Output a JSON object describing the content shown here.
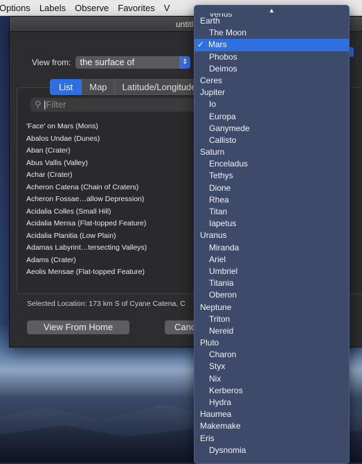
{
  "menubar": {
    "items": [
      "Options",
      "Labels",
      "Observe",
      "Favorites",
      "V"
    ]
  },
  "window": {
    "title": "untitle"
  },
  "view_from": {
    "label": "View from:",
    "value": "the surface of"
  },
  "tabs": [
    "List",
    "Map",
    "Latitude/Longitude"
  ],
  "search": {
    "placeholder": "Filter"
  },
  "locations": [
    "'Face' on Mars (Mons)",
    "Abalos Undae (Dunes)",
    "Aban (Crater)",
    "Abus Vallis (Valley)",
    "Achar (Crater)",
    "Acheron Catena (Chain of Craters)",
    "Acheron Fossae…allow Depression)",
    "Acidalia Colles (Small Hill)",
    "Acidalia Mensa (Flat-topped Feature)",
    "Acidalia Planitia (Low Plain)",
    "Adamas Labyrint…tersecting Valleys)",
    "Adams (Crater)",
    "Aeolis Mensae (Flat-topped Feature)"
  ],
  "selected_location": "Selected Location:  173 km S of Cyane Catena, C",
  "buttons": {
    "home": "View From Home",
    "cancel": "Canc"
  },
  "popup": {
    "up_arrow": "▲",
    "cut_item": "Venus",
    "selected_check": "✓",
    "items": [
      {
        "label": "Earth",
        "indent": 0
      },
      {
        "label": "The Moon",
        "indent": 1
      },
      {
        "label": "Mars",
        "indent": 0,
        "selected": true
      },
      {
        "label": "Phobos",
        "indent": 1
      },
      {
        "label": "Deimos",
        "indent": 1
      },
      {
        "label": "Ceres",
        "indent": 0
      },
      {
        "label": "Jupiter",
        "indent": 0
      },
      {
        "label": "Io",
        "indent": 1
      },
      {
        "label": "Europa",
        "indent": 1
      },
      {
        "label": "Ganymede",
        "indent": 1
      },
      {
        "label": "Callisto",
        "indent": 1
      },
      {
        "label": "Saturn",
        "indent": 0
      },
      {
        "label": "Enceladus",
        "indent": 1
      },
      {
        "label": "Tethys",
        "indent": 1
      },
      {
        "label": "Dione",
        "indent": 1
      },
      {
        "label": "Rhea",
        "indent": 1
      },
      {
        "label": "Titan",
        "indent": 1
      },
      {
        "label": "Iapetus",
        "indent": 1
      },
      {
        "label": "Uranus",
        "indent": 0
      },
      {
        "label": "Miranda",
        "indent": 1
      },
      {
        "label": "Ariel",
        "indent": 1
      },
      {
        "label": "Umbriel",
        "indent": 1
      },
      {
        "label": "Titania",
        "indent": 1
      },
      {
        "label": "Oberon",
        "indent": 1
      },
      {
        "label": "Neptune",
        "indent": 0
      },
      {
        "label": "Triton",
        "indent": 1
      },
      {
        "label": "Nereid",
        "indent": 1
      },
      {
        "label": "Pluto",
        "indent": 0
      },
      {
        "label": "Charon",
        "indent": 1
      },
      {
        "label": "Styx",
        "indent": 1
      },
      {
        "label": "Nix",
        "indent": 1
      },
      {
        "label": "Kerberos",
        "indent": 1
      },
      {
        "label": "Hydra",
        "indent": 1
      },
      {
        "label": "Haumea",
        "indent": 0
      },
      {
        "label": "Makemake",
        "indent": 0
      },
      {
        "label": "Eris",
        "indent": 0
      },
      {
        "label": "Dysnomia",
        "indent": 1
      }
    ]
  },
  "colors": {
    "accent": "#2f6fe0",
    "menu_bg": "#3e4a6a",
    "window_bg": "#2d2d2f"
  }
}
